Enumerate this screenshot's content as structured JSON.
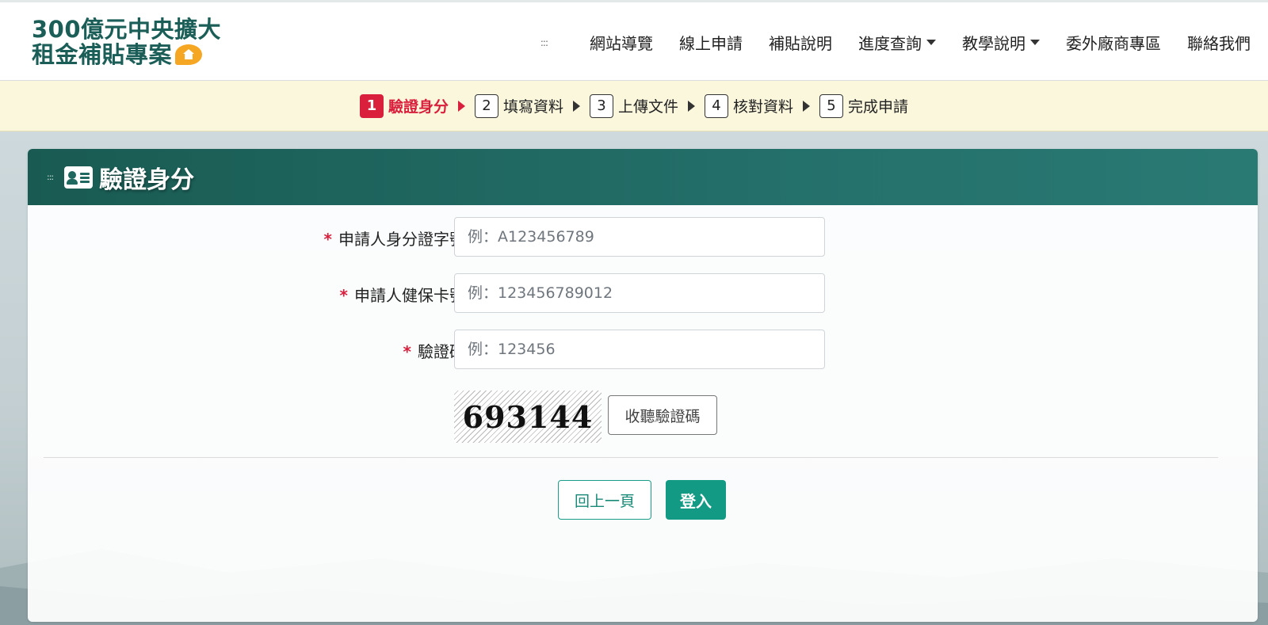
{
  "logo": {
    "line1": "300億元中央擴大",
    "line2": "租金補貼專案",
    "icon": "house-icon"
  },
  "nav": {
    "items": [
      {
        "label": "網站導覽",
        "dropdown": false
      },
      {
        "label": "線上申請",
        "dropdown": false
      },
      {
        "label": "補貼說明",
        "dropdown": false
      },
      {
        "label": "進度查詢",
        "dropdown": true
      },
      {
        "label": "教學說明",
        "dropdown": true
      },
      {
        "label": "委外廠商專區",
        "dropdown": false
      },
      {
        "label": "聯絡我們",
        "dropdown": false
      }
    ]
  },
  "steps": [
    {
      "num": "1",
      "label": "驗證身分",
      "active": true
    },
    {
      "num": "2",
      "label": "填寫資料",
      "active": false
    },
    {
      "num": "3",
      "label": "上傳文件",
      "active": false
    },
    {
      "num": "4",
      "label": "核對資料",
      "active": false
    },
    {
      "num": "5",
      "label": "完成申請",
      "active": false
    }
  ],
  "card": {
    "title": "驗證身分",
    "icon": "id-card-icon"
  },
  "form": {
    "required_mark": "*",
    "id_number": {
      "label": "申請人身分證字號",
      "placeholder": "例：A123456789",
      "value": ""
    },
    "health_card": {
      "label": "申請人健保卡號",
      "placeholder": "例：123456789012",
      "value": ""
    },
    "captcha": {
      "label": "驗證碼",
      "placeholder": "例：123456",
      "value": ""
    },
    "captcha_image_text": "693144",
    "listen_button": "收聽驗證碼"
  },
  "actions": {
    "back": "回上一頁",
    "login": "登入"
  },
  "colors": {
    "brand": "#1b5e57",
    "accent_red": "#d91f3c",
    "teal_button": "#129a85",
    "steps_bg": "#fbf7dd"
  }
}
